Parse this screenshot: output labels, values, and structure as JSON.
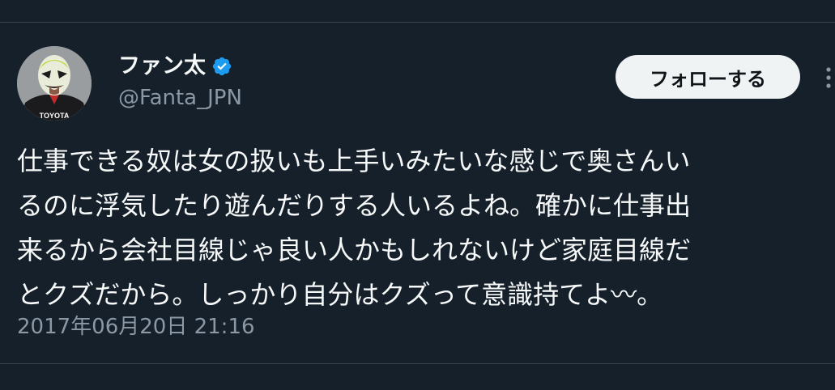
{
  "tweet": {
    "author": {
      "display_name": "ファン太",
      "handle": "@Fanta_JPN",
      "verified_icon": "verified-badge-icon",
      "avatar_jersey_text": "TOYOTA"
    },
    "follow_label": "フォローする",
    "more_icon": "more-vertical-icon",
    "text_lines": [
      "仕事できる奴は女の扱いも上手いみたいな感じで奥さんい",
      "るのに浮気したり遊んだりする人いるよね。確かに仕事出",
      "来るから会社目線じゃ良い人かもしれないけど家庭目線だ",
      "とクズだから。しっかり自分はクズって意識持てよ〰。"
    ],
    "timestamp": "2017年06月20日 21:16"
  },
  "colors": {
    "background": "#15202b",
    "text_primary": "#f7f9f9",
    "text_secondary": "#8b98a5",
    "verified_blue": "#1d9bf0",
    "divider": "#38444d",
    "button_bg": "#eff3f4",
    "button_text": "#0f1419"
  }
}
